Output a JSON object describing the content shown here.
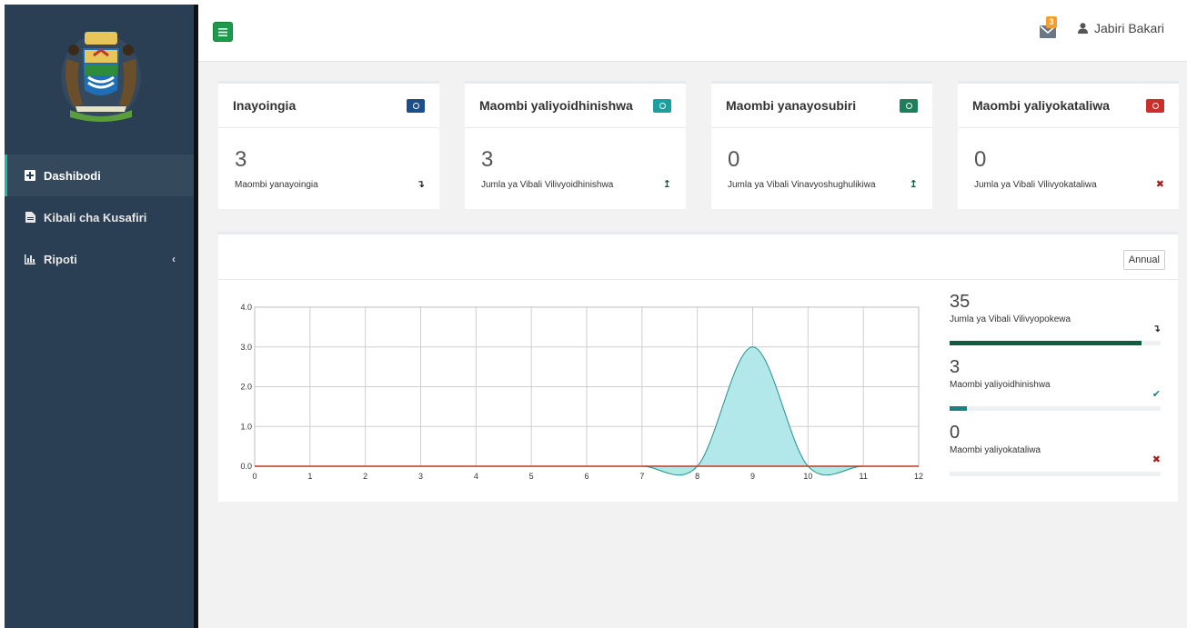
{
  "user": {
    "name": "Jabiri Bakari",
    "mail_count": "3"
  },
  "sidebar": {
    "items": [
      {
        "label": "Dashibodi",
        "icon": "plus-square-icon",
        "active": true
      },
      {
        "label": "Kibali cha Kusafiri",
        "icon": "file-icon",
        "active": false
      },
      {
        "label": "Ripoti",
        "icon": "bar-chart-icon",
        "active": false,
        "chevron": "‹"
      }
    ]
  },
  "cards": [
    {
      "title": "Inayoingia",
      "value": "3",
      "subtitle": "Maombi yanayoingia",
      "pill_color": "#1a4f8b",
      "trend": "↴",
      "trend_color": "#222"
    },
    {
      "title": "Maombi yaliyoidhinishwa",
      "value": "3",
      "subtitle": "Jumla ya Vibali Vilivyoidhinishwa",
      "pill_color": "#1f9e9e",
      "trend": "↥",
      "trend_color": "#0f5c3e"
    },
    {
      "title": "Maombi yanayosubiri",
      "value": "0",
      "subtitle": "Jumla ya Vibali Vinavyoshughulikiwa",
      "pill_color": "#1a7f5a",
      "trend": "↥",
      "trend_color": "#0f5c3e"
    },
    {
      "title": "Maombi yaliyokataliwa",
      "value": "0",
      "subtitle": "Jumla ya Vibali Vilivyokataliwa",
      "pill_color": "#c9302c",
      "trend": "✖",
      "trend_color": "#a61b1b"
    }
  ],
  "panel": {
    "period_button": "Annual",
    "stats": [
      {
        "value": "35",
        "label": "Jumla ya Vibali Vilivyopokewa",
        "icon": "↴",
        "icon_color": "#222",
        "progress": 0.91,
        "bar_color": "#0f5c3e"
      },
      {
        "value": "3",
        "label": "Maombi yaliyoidhinishwa",
        "icon": "✔",
        "icon_color": "#1f7f7f",
        "progress": 0.08,
        "bar_color": "#1f7f7f"
      },
      {
        "value": "0",
        "label": "Maombi yaliyokataliwa",
        "icon": "✖",
        "icon_color": "#a61b1b",
        "progress": 0,
        "bar_color": "#a61b1b"
      }
    ]
  },
  "chart_data": {
    "type": "area",
    "x_ticks": [
      0,
      1,
      2,
      3,
      4,
      5,
      6,
      7,
      8,
      9,
      10,
      11,
      12
    ],
    "y_ticks": [
      "0.0",
      "1.0",
      "2.0",
      "3.0",
      "4.0"
    ],
    "xlim": [
      0,
      12
    ],
    "ylim": [
      0,
      4
    ],
    "grid": true,
    "series": [
      {
        "color": "#1f8f8f",
        "fill": "#b3e8ea",
        "x": [
          0,
          1,
          2,
          3,
          4,
          5,
          6,
          7,
          8,
          9,
          10,
          11,
          12
        ],
        "y": [
          0,
          0,
          0,
          0,
          0,
          0,
          0,
          0,
          0,
          3,
          0,
          0,
          0
        ]
      },
      {
        "color": "#c0392b",
        "fill": "none",
        "x": [
          0,
          1,
          2,
          3,
          4,
          5,
          6,
          7,
          8,
          9,
          10,
          11,
          12
        ],
        "y": [
          0,
          0,
          0,
          0,
          0,
          0,
          0,
          0,
          0,
          0,
          0,
          0,
          0
        ]
      }
    ]
  }
}
